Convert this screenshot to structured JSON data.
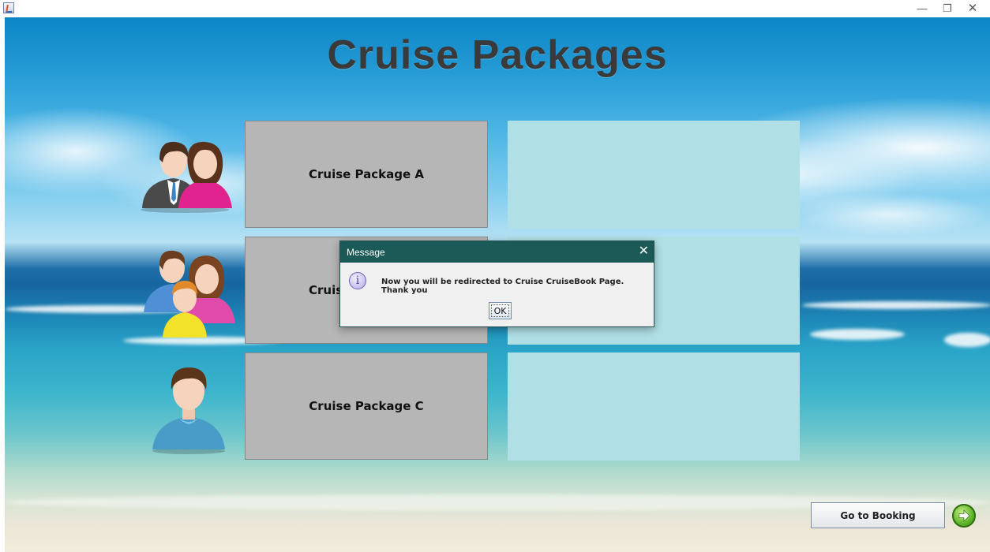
{
  "window": {
    "app_icon": "java-cup-icon",
    "minimize_icon": "minimize-icon",
    "maximize_icon": "restore-icon",
    "close_icon": "close-icon"
  },
  "page": {
    "title": "Cruise Packages"
  },
  "packages": [
    {
      "label": "Cruise Package A",
      "avatar": "couple-avatar-icon"
    },
    {
      "label": "Cruis",
      "avatar": "family-avatar-icon"
    },
    {
      "label": "Cruise Package C",
      "avatar": "single-person-avatar-icon"
    }
  ],
  "footer": {
    "goto_label": "Go to Booking",
    "next_icon": "green-arrow-right-icon"
  },
  "dialog": {
    "title": "Message",
    "message": "Now you will be redirected to Cruise CruiseBook Page. Thank you",
    "ok_label": "OK",
    "icon": "information-icon"
  },
  "colors": {
    "package_button_bg": "#b6b6b6",
    "description_panel_bg": "#b0dfe5",
    "dialog_titlebar_bg": "#1c5a58",
    "title_text": "#3a3a3a"
  }
}
